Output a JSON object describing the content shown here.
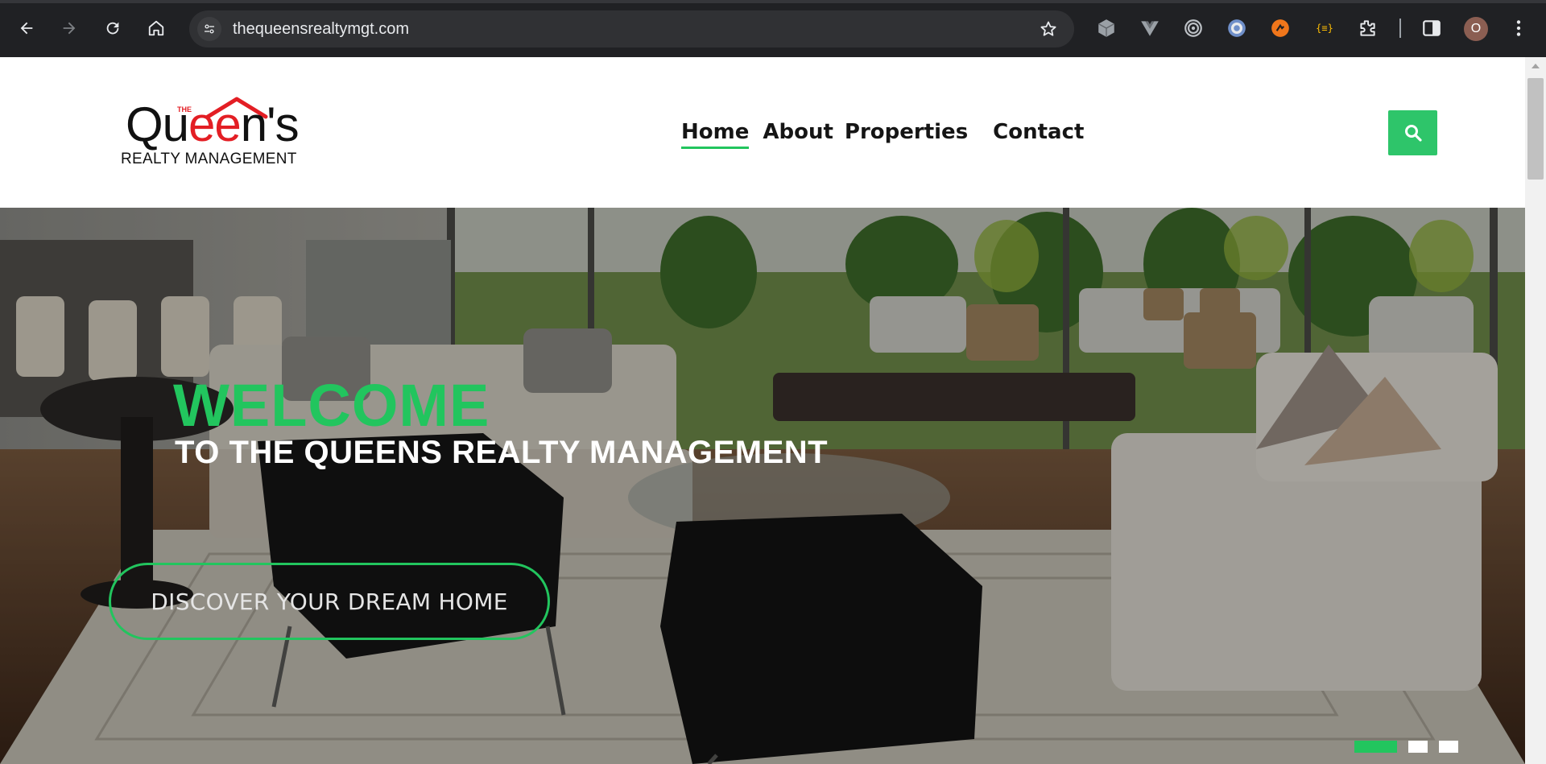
{
  "browser": {
    "url": "thequeensrealtymgt.com",
    "profile_initial": "O",
    "toolbar_icons": [
      "back-icon",
      "forward-icon",
      "reload-icon",
      "home-icon",
      "site-settings-icon",
      "bookmark-star-icon"
    ],
    "extensions": [
      "cube-extension-icon",
      "vue-extension-icon",
      "target-extension-icon",
      "ring-extension-icon",
      "orange-extension-icon",
      "code-braces-extension-icon",
      "puzzle-extensions-icon",
      "side-panel-icon",
      "kebab-menu-icon"
    ],
    "code_ext_label": "{≡}"
  },
  "site": {
    "logo": {
      "the": "THE",
      "word_left": "Qu",
      "word_mid": "ee",
      "word_right": "n's",
      "sub": "REALTY MANAGEMENT"
    },
    "menu": [
      {
        "label": "Home",
        "active": true
      },
      {
        "label": "About",
        "active": false
      },
      {
        "label": "Properties",
        "active": false
      },
      {
        "label": "Contact",
        "active": false
      }
    ],
    "search_icon": "search-icon",
    "accent_color": "#22c55e"
  },
  "hero": {
    "welcome": "WELCOME",
    "tagline": "TO THE QUEENS REALTY MANAGEMENT",
    "cta": "DISCOVER YOUR DREAM HOME",
    "slides": 3,
    "active_slide": 1
  }
}
